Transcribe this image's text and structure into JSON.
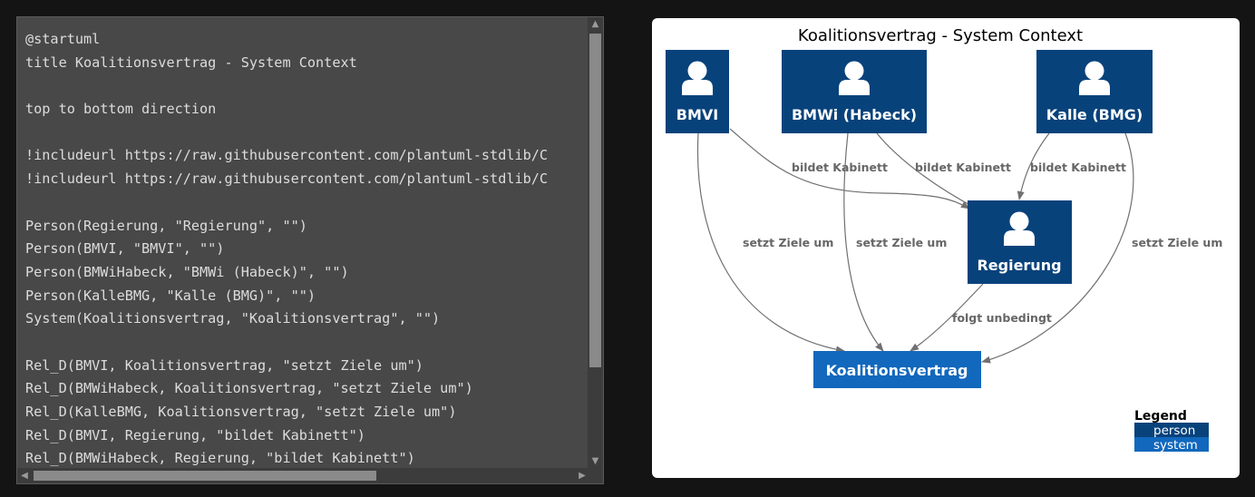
{
  "editor": {
    "lines": [
      "@startuml",
      "title Koalitionsvertrag - System Context",
      "",
      "top to bottom direction",
      "",
      "!includeurl https://raw.githubusercontent.com/plantuml-stdlib/C",
      "!includeurl https://raw.githubusercontent.com/plantuml-stdlib/C",
      "",
      "Person(Regierung, \"Regierung\", \"\")",
      "Person(BMVI, \"BMVI\", \"\")",
      "Person(BMWiHabeck, \"BMWi (Habeck)\", \"\")",
      "Person(KalleBMG, \"Kalle (BMG)\", \"\")",
      "System(Koalitionsvertrag, \"Koalitionsvertrag\", \"\")",
      "",
      "Rel_D(BMVI, Koalitionsvertrag, \"setzt Ziele um\")",
      "Rel_D(BMWiHabeck, Koalitionsvertrag, \"setzt Ziele um\")",
      "Rel_D(KalleBMG, Koalitionsvertrag, \"setzt Ziele um\")",
      "Rel_D(BMVI, Regierung, \"bildet Kabinett\")",
      "Rel_D(BMWiHabeck, Regierung, \"bildet Kabinett\")"
    ]
  },
  "diagram": {
    "title": "Koalitionsvertrag - System Context",
    "nodes": {
      "bmvi": "BMVI",
      "bmwi": "BMWi (Habeck)",
      "kalle": "Kalle (BMG)",
      "regierung": "Regierung",
      "koalitionsvertrag": "Koalitionsvertrag"
    },
    "edges": {
      "bmvi_koal": "setzt Ziele um",
      "bmwi_koal": "setzt Ziele um",
      "kalle_koal": "setzt Ziele um",
      "bmvi_reg": "bildet Kabinett",
      "bmwi_reg": "bildet Kabinett",
      "kalle_reg": "bildet Kabinett",
      "reg_koal": "folgt unbedingt"
    },
    "legend": {
      "title": "Legend",
      "person": "person",
      "system": "system"
    },
    "colors": {
      "person": "#08427b",
      "system": "#1168bd",
      "edge": "#707070"
    }
  }
}
